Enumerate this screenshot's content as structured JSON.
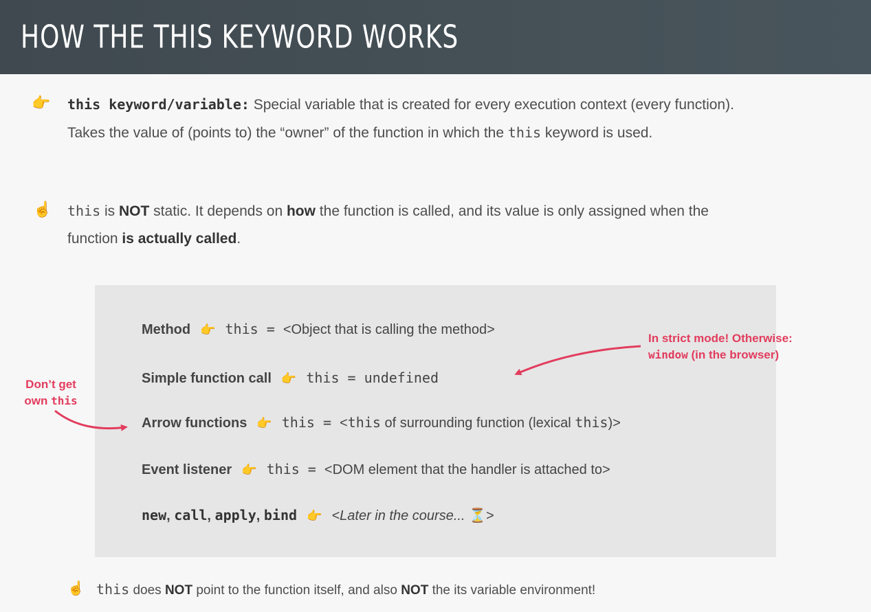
{
  "header": {
    "title": "How the this keyword works"
  },
  "bullets": [
    {
      "icon": "👉",
      "term": "this keyword/variable:",
      "line1": " Special variable that is created for every execution context (every function).",
      "line2_a": "Takes the value of (points to) the “owner” of the function in which the ",
      "line2_code": "this",
      "line2_b": " keyword is used."
    },
    {
      "icon": "☝️",
      "code": "this",
      "t1": " is ",
      "not": "NOT",
      "t2": " static. It depends on ",
      "how": "how",
      "t3": " the function is called, and its value is only assigned when the",
      "t4": "function ",
      "called": "is actually called",
      "t5": "."
    }
  ],
  "table": {
    "hand": "👉",
    "rows": [
      {
        "label": "Method",
        "code": "this",
        "eq": " = ",
        "value": "<Object that is calling the method>"
      },
      {
        "label": "Simple function call",
        "code": "this",
        "eq": " = ",
        "value_code": "undefined"
      },
      {
        "label": "Arrow functions",
        "code": "this",
        "eq": " = ",
        "v1": "<",
        "v_code": "this",
        "v2": " of surrounding function (lexical ",
        "v_code2": "this",
        "v3": ")>"
      },
      {
        "label": "Event listener",
        "code": "this",
        "eq": " = ",
        "value": "<DOM element that the handler is attached to>"
      },
      {
        "label_a": "new",
        "label_b": ", ",
        "label_c": "call",
        "label_d": ", ",
        "label_e": "apply",
        "label_f": ", ",
        "label_g": "bind",
        "value": "<Later in the course... ",
        "hourglass": "⏳",
        "close": ">"
      }
    ]
  },
  "notes": {
    "strict_line1": "In strict mode! Otherwise:",
    "strict_code": "window",
    "strict_rest": " (in the browser)",
    "arrow_line1": "Don’t get",
    "arrow_line2a": "own ",
    "arrow_code": "this"
  },
  "footer": {
    "icon": "☝️",
    "code": "this",
    "t1": " does ",
    "not1": "NOT",
    "t2": " point to the function itself, and also ",
    "not2": "NOT",
    "t3": " the its variable environment!"
  },
  "colors": {
    "accent": "#e23c5d",
    "header_bg": "#444f55",
    "box_bg": "#e6e6e6"
  }
}
